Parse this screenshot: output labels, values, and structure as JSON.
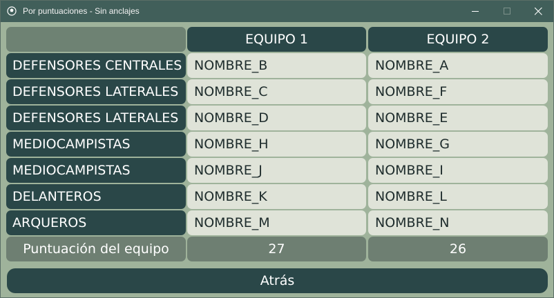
{
  "window": {
    "title": "Por puntuaciones - Sin anclajes",
    "icon": "soccer-ball-icon",
    "controls": [
      "minimize-icon",
      "maximize-icon",
      "close-icon"
    ]
  },
  "table": {
    "headers": [
      "EQUIPO 1",
      "EQUIPO 2"
    ],
    "rows": [
      {
        "position": "DEFENSORES CENTRALES",
        "team1": "NOMBRE_B",
        "team2": "NOMBRE_A"
      },
      {
        "position": "DEFENSORES LATERALES",
        "team1": "NOMBRE_C",
        "team2": "NOMBRE_F"
      },
      {
        "position": "DEFENSORES LATERALES",
        "team1": "NOMBRE_D",
        "team2": "NOMBRE_E"
      },
      {
        "position": "MEDIOCAMPISTAS",
        "team1": "NOMBRE_H",
        "team2": "NOMBRE_G"
      },
      {
        "position": "MEDIOCAMPISTAS",
        "team1": "NOMBRE_J",
        "team2": "NOMBRE_I"
      },
      {
        "position": "DELANTEROS",
        "team1": "NOMBRE_K",
        "team2": "NOMBRE_L"
      },
      {
        "position": "ARQUEROS",
        "team1": "NOMBRE_M",
        "team2": "NOMBRE_N"
      }
    ],
    "score_label": "Puntuación del equipo",
    "scores": [
      "27",
      "26"
    ]
  },
  "back_button": "Atrás",
  "colors": {
    "background": "#9fb39b",
    "titlebar": "#415f5a",
    "dark_cell": "#2a4748",
    "light_cell": "#dfe3d8",
    "gray_cell": "#6e7f72"
  }
}
